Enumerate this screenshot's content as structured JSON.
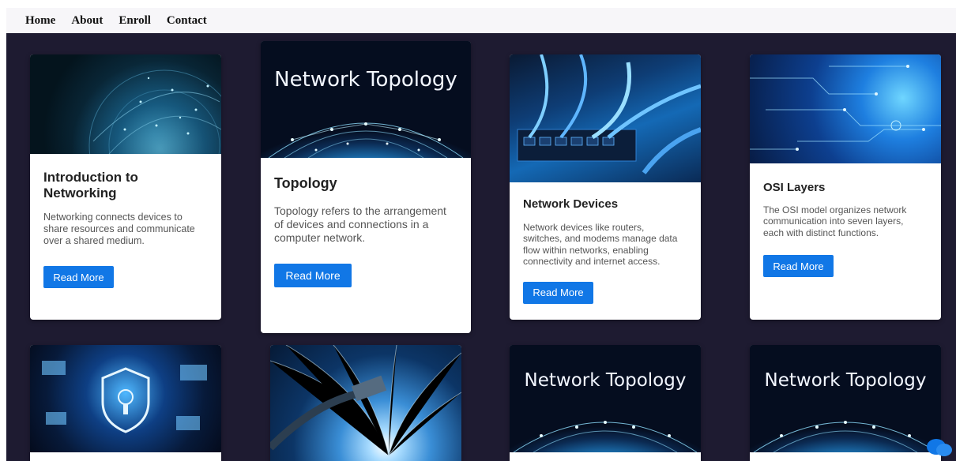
{
  "nav": {
    "items": [
      "Home",
      "About",
      "Enroll",
      "Contact"
    ]
  },
  "cards": [
    {
      "image": "globe-network-image",
      "image_text": "",
      "title": "Introduction to Networking",
      "description": "Networking connects devices to share resources and communicate over a shared medium.",
      "button": "Read More"
    },
    {
      "image": "network-topology-image",
      "image_text": "Network Topology",
      "title": "Topology",
      "description": "Topology refers to the arrangement of devices and connections in a computer network.",
      "button": "Read More"
    },
    {
      "image": "network-switch-cables-image",
      "image_text": "",
      "title": "Network Devices",
      "description": "Network devices like routers, switches, and modems manage data flow within networks, enabling connectivity and internet access.",
      "button": "Read More"
    },
    {
      "image": "digital-circuit-image",
      "image_text": "",
      "title": "OSI Layers",
      "description": "The OSI model organizes network communication into seven layers, each with distinct functions.",
      "button": "Read More"
    },
    {
      "image": "security-shield-image",
      "image_text": ""
    },
    {
      "image": "fiber-optic-cable-image",
      "image_text": ""
    },
    {
      "image": "network-topology-image",
      "image_text": "Network Topology"
    },
    {
      "image": "network-topology-image",
      "image_text": "Network Topology"
    }
  ],
  "colors": {
    "page_background": "#1e1b31",
    "nav_background": "#f7f6f9",
    "button": "#1177e6"
  }
}
